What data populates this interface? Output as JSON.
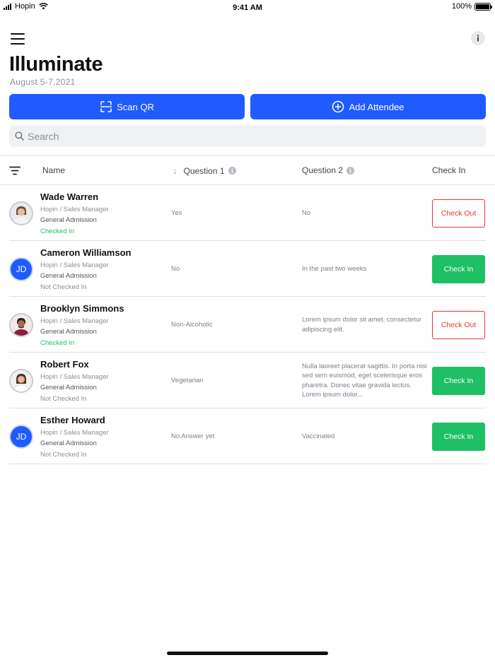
{
  "status_bar": {
    "carrier": "Hopin",
    "time": "9:41 AM",
    "battery": "100%"
  },
  "header": {
    "title": "Illuminate",
    "date": "August 5-7,2021",
    "menu_icon": "hamburger-menu-icon",
    "info_icon": "info-icon"
  },
  "actions": {
    "scan_label": "Scan QR",
    "add_label": "Add Attendee"
  },
  "search": {
    "placeholder": "Search"
  },
  "table": {
    "columns": {
      "name": "Name",
      "question1": "Question 1",
      "question2": "Question 2",
      "check_in": "Check In"
    },
    "rows": [
      {
        "name": "Wade Warren",
        "role": "Hopin / Sales Manager",
        "ticket": "General Admission",
        "status": "Checked In",
        "q1": "Yes",
        "q2": "No",
        "action": "Check Out",
        "avatar": "photo"
      },
      {
        "name": "Cameron Williamson",
        "role": "Hopin / Sales Manager",
        "ticket": "General Admission",
        "status": "Not Checked In",
        "q1": "No",
        "q2": "In the past two weeks",
        "action": "Check In",
        "avatar": "JD"
      },
      {
        "name": "Brooklyn Simmons",
        "role": "Hopin / Sales Manager",
        "ticket": "General Admission",
        "status": "Checked In",
        "q1": "Non-Alcoholic",
        "q2": "Lorem ipsum dolor sit amet, consectetur adipiscing elit.",
        "action": "Check Out",
        "avatar": "photo"
      },
      {
        "name": "Robert Fox",
        "role": "Hopin / Sales Manager",
        "ticket": "General Admission",
        "status": "Not Checked In",
        "q1": "Vegetarian",
        "q2": "Nulla laoreet placerat sagittis. In porta nisi sed sem euismod, eget scelerisque eros pharetra. Donec vitae gravida lectus. Lorem ipsum dolor...",
        "action": "Check In",
        "avatar": "photo"
      },
      {
        "name": "Esther Howard",
        "role": "Hopin / Sales Manager",
        "ticket": "General Admission",
        "status": "Not Checked In",
        "q1": "No Answer yet",
        "q2": "Vaccinated",
        "action": "Check In",
        "avatar": "JD"
      }
    ]
  },
  "colors": {
    "primary": "#1f5bff",
    "success": "#1fbf66",
    "danger": "#e53935"
  }
}
